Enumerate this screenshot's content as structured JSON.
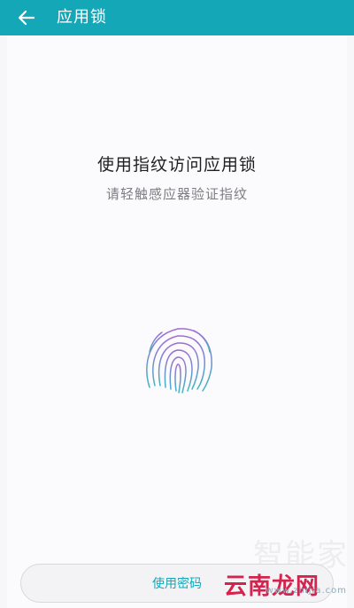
{
  "header": {
    "title": "应用锁",
    "back_icon": "arrow-left-icon",
    "background": "#14a7b8"
  },
  "main": {
    "title": "使用指纹访问应用锁",
    "subtitle": "请轻触感应器验证指纹",
    "fingerprint_icon": "fingerprint-icon",
    "fingerprint_colors": [
      "#a06bd8",
      "#3fb7c2"
    ]
  },
  "footer": {
    "password_button": "使用密码",
    "accent": "#14a7b8"
  },
  "watermark": {
    "top": "智能家",
    "site": "www.zhijia.com",
    "overlay": "云南龙网",
    "overlay_color": "#d4234f"
  }
}
